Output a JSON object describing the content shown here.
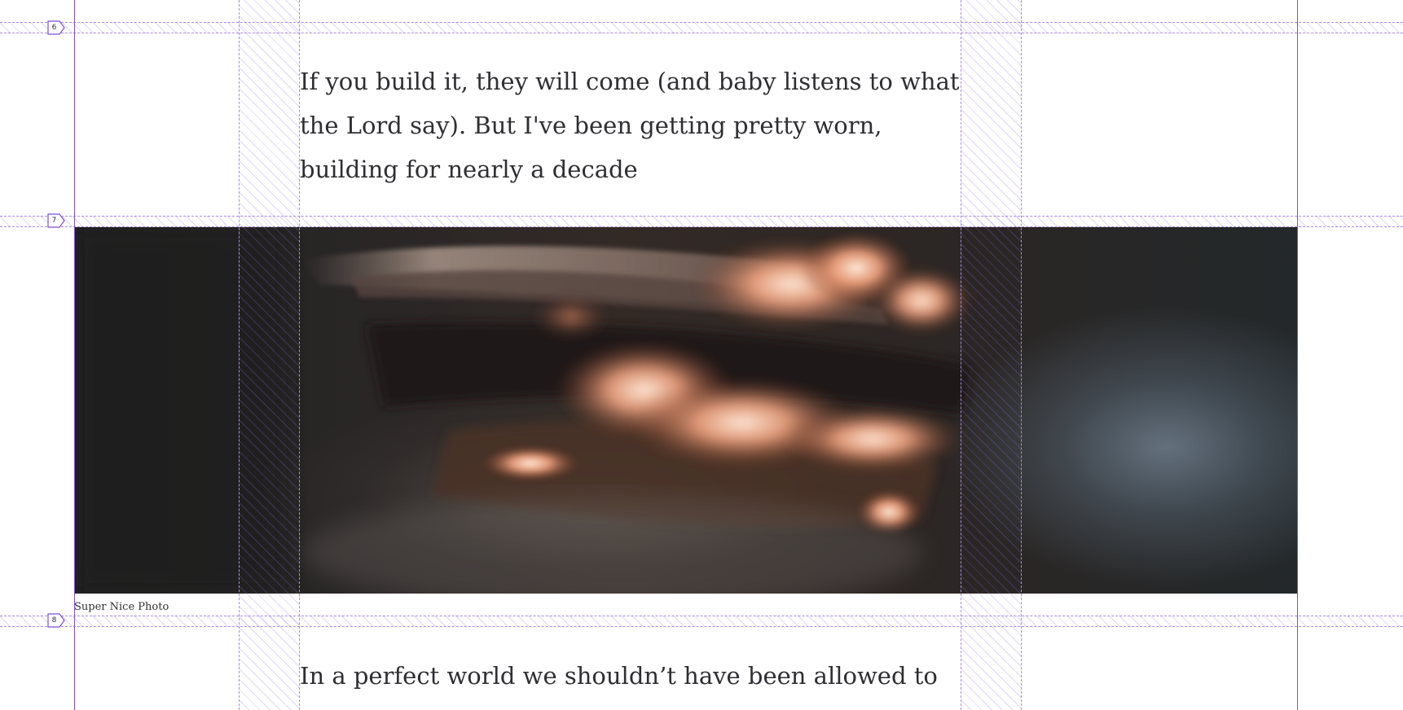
{
  "grid": {
    "rows": [
      {
        "number": "6"
      },
      {
        "number": "7"
      },
      {
        "number": "8"
      }
    ]
  },
  "content": {
    "paragraph_1": "If you build it, they will come (and baby listens to what the Lord say). But I've been getting pretty worn, building for nearly a decade",
    "image_caption": "Super Nice Photo",
    "paragraph_2": "In a perfect world we shouldn’t have been allowed to lose sight"
  },
  "colors": {
    "grid_line": "#7b4fd6",
    "grid_hatch": "#a98be4",
    "text": "#2f2f33",
    "background": "#ffffff"
  }
}
